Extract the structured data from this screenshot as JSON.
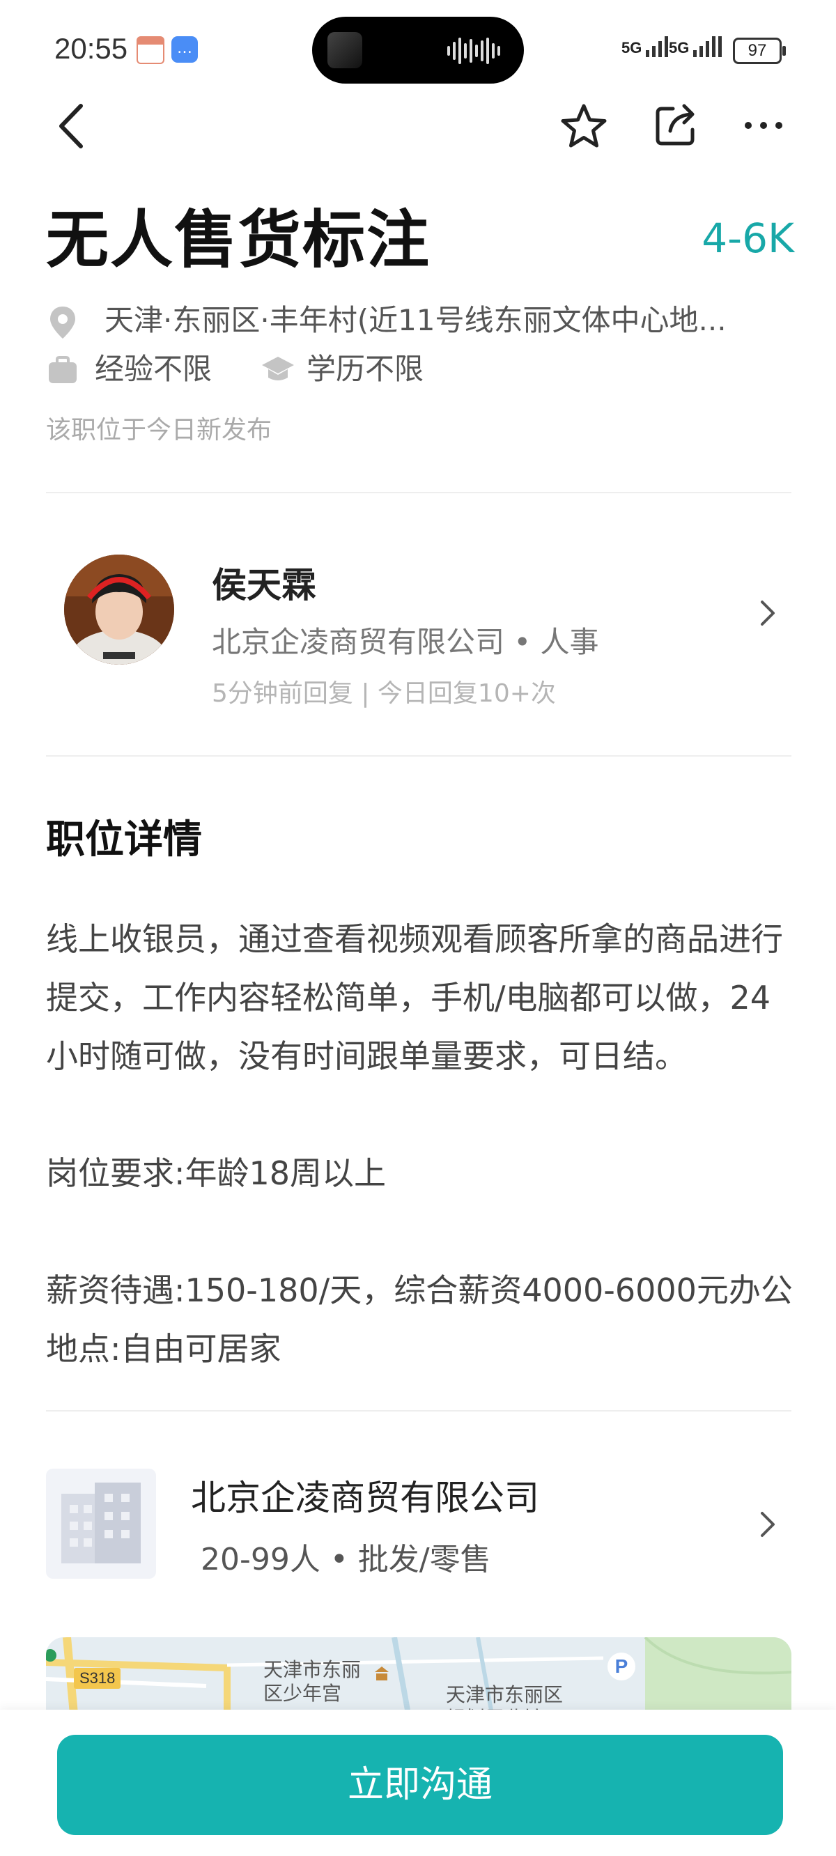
{
  "status_bar": {
    "time": "20:55",
    "signal_1": "5G",
    "signal_2": "5G",
    "battery": "97"
  },
  "nav": {
    "back_icon": "chevron-left-icon",
    "favorite_icon": "star-icon",
    "share_icon": "share-icon",
    "more_icon": "more-icon"
  },
  "job": {
    "title": "无人售货标注",
    "salary": "4-6K",
    "location": "天津·东丽区·丰年村(近11号线东丽文体中心地...",
    "experience": "经验不限",
    "education": "学历不限",
    "posted_note": "该职位于今日新发布"
  },
  "recruiter": {
    "name": "侯天霖",
    "company_role": "北京企凌商贸有限公司 • 人事",
    "reply_info": "5分钟前回复 | 今日回复10+次"
  },
  "detail": {
    "section_title": "职位详情",
    "paragraph_1": "线上收银员，通过查看视频观看顾客所拿的商品进行提交，工作内容轻松简单，手机/电脑都可以做，24小时随可做，没有时间跟单量要求，可日结。",
    "paragraph_2": "岗位要求:年龄18周以上",
    "paragraph_3": "薪资待遇:150-180/天，综合薪资4000-6000元办公地点:自由可居家"
  },
  "company": {
    "name": "北京企凌商贸有限公司",
    "info": "20-99人 • 批发/零售"
  },
  "map": {
    "road_tag": "S318",
    "label_1": "天津市东丽区少年宫",
    "label_2": "天津市东丽区规划展览馆",
    "parking": "P"
  },
  "cta": {
    "label": "立即沟通"
  },
  "colors": {
    "accent": "#16b3b0",
    "salary": "#18a8a8"
  }
}
